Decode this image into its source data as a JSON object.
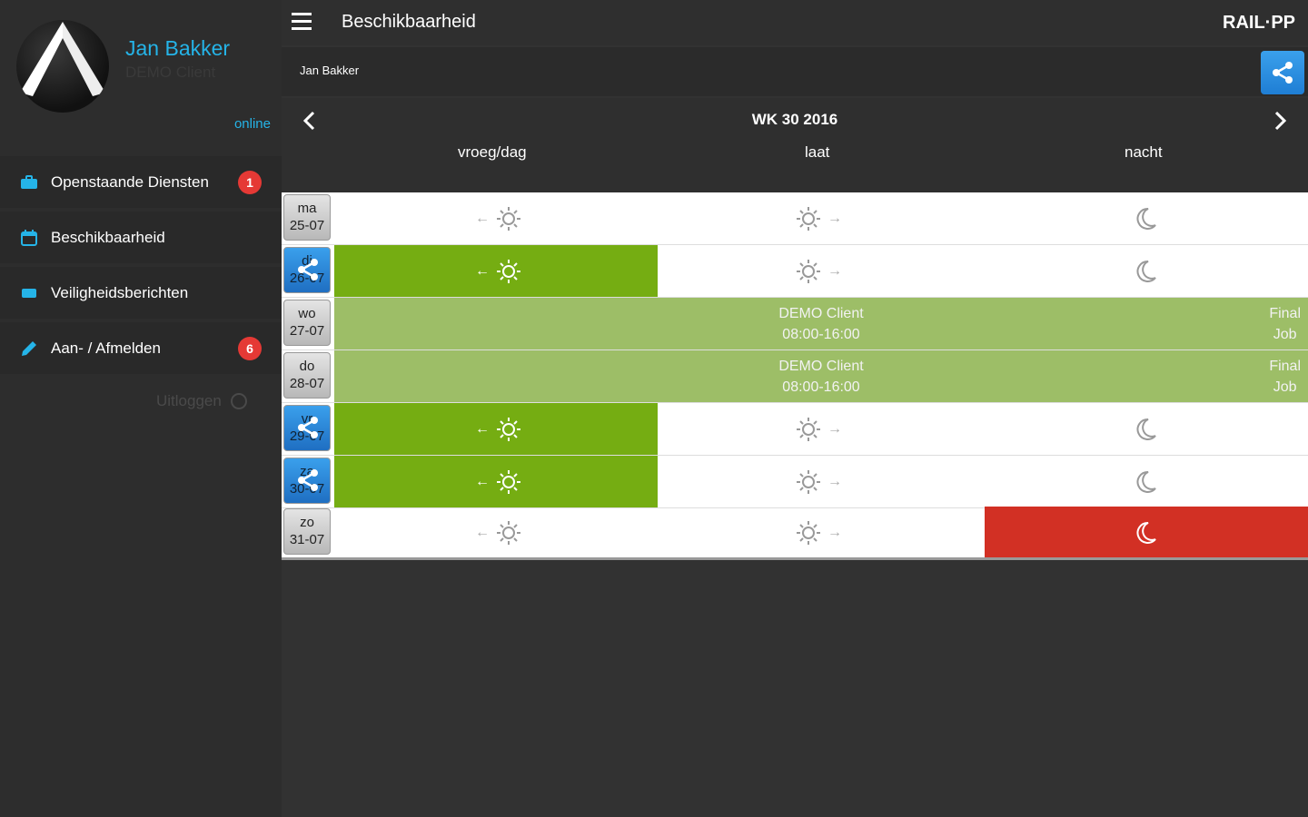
{
  "profile": {
    "name": "Jan Bakker",
    "client": "DEMO Client",
    "status": "online"
  },
  "sidebar": {
    "items": [
      {
        "label": "Openstaande Diensten",
        "icon": "briefcase-icon",
        "badge": "1"
      },
      {
        "label": "Beschikbaarheid",
        "icon": "calendar-icon",
        "badge": ""
      },
      {
        "label": "Veiligheidsberichten",
        "icon": "message-icon",
        "badge": ""
      },
      {
        "label": "Aan- / Afmelden",
        "icon": "pencil-icon",
        "badge": "6"
      }
    ],
    "logout": "Uitloggen"
  },
  "header": {
    "title": "Beschikbaarheid",
    "logo": "RAIL·PP",
    "user": "Jan Bakker"
  },
  "week": {
    "title": "WK 30 2016",
    "columns": [
      "vroeg/dag",
      "laat",
      "nacht"
    ]
  },
  "days": [
    {
      "day": "ma",
      "date": "25-07",
      "shared": false
    },
    {
      "day": "di",
      "date": "26-07",
      "shared": true
    },
    {
      "day": "wo",
      "date": "27-07",
      "shared": false
    },
    {
      "day": "do",
      "date": "28-07",
      "shared": false
    },
    {
      "day": "vr",
      "date": "29-07",
      "shared": true
    },
    {
      "day": "za",
      "date": "30-07",
      "shared": true
    },
    {
      "day": "zo",
      "date": "31-07",
      "shared": false
    }
  ],
  "jobs": [
    {
      "client": "DEMO Client",
      "time": "08:00-16:00",
      "label_line1": "Final",
      "label_line2": "Job"
    },
    {
      "client": "DEMO Client",
      "time": "08:00-16:00",
      "label_line1": "Final",
      "label_line2": "Job"
    }
  ],
  "colors": {
    "accent": "#25b4e8",
    "available": "#75ad12",
    "job": "#9dbe67",
    "unavailable": "#d23024",
    "badge": "#e53935"
  }
}
